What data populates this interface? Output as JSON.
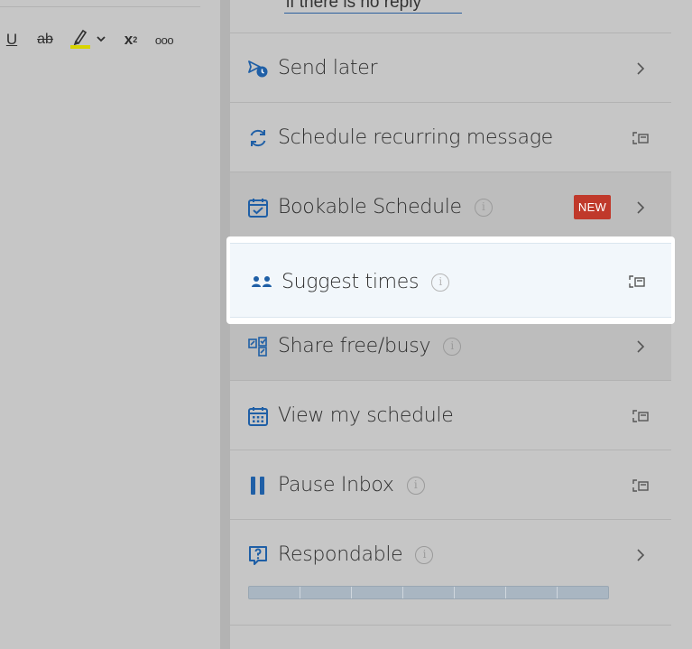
{
  "composer": {
    "toolbar": [
      {
        "name": "underline-button",
        "label": "U"
      },
      {
        "name": "strikethrough-button",
        "label": "ab"
      },
      {
        "name": "highlight-button",
        "icon": "highlighter-icon"
      },
      {
        "name": "highlight-dropdown-button",
        "icon": "chevron-down-icon"
      },
      {
        "name": "superscript-button",
        "label": "x",
        "sup": "2"
      },
      {
        "name": "more-formatting-button",
        "label": "ooo"
      }
    ]
  },
  "reply_dropdown": {
    "value": "if there is no reply"
  },
  "menu": {
    "items": [
      {
        "label": "Send later",
        "icon": "send-later-icon",
        "trail": "chevron-right-icon"
      },
      {
        "label": "Schedule recurring message",
        "icon": "recurring-icon",
        "trail": "expand-icon"
      },
      {
        "label": "Bookable Schedule",
        "icon": "calendar-check-icon",
        "trail": "chevron-right-icon",
        "info": true,
        "badge": "NEW"
      },
      {
        "label": "Suggest times",
        "icon": "suggest-times-icon",
        "trail": "expand-icon",
        "info": true,
        "highlighted": true
      },
      {
        "label": "Share free/busy",
        "icon": "share-free-busy-icon",
        "trail": "chevron-right-icon",
        "info": true
      },
      {
        "label": "View my schedule",
        "icon": "calendar-grid-icon",
        "trail": "expand-icon"
      },
      {
        "label": "Pause Inbox",
        "icon": "pause-icon",
        "trail": "expand-icon",
        "info": true
      },
      {
        "label": "Respondable",
        "icon": "question-box-icon",
        "trail": "chevron-right-icon",
        "info": true
      }
    ]
  },
  "colors": {
    "accent": "#1f5fa6",
    "badge": "#c0392b",
    "highlight_bg": "#f2f7fb"
  }
}
